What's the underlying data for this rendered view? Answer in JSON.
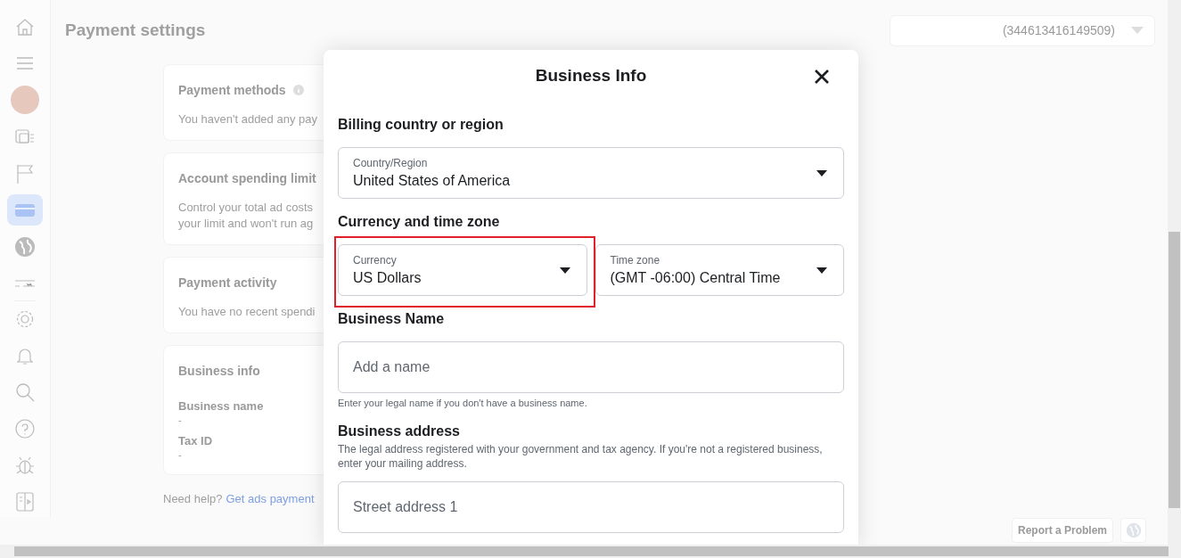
{
  "sidebar": {
    "items": [
      {
        "selected": false
      },
      {
        "selected": false
      },
      {
        "selected": false
      },
      {
        "selected": false
      },
      {
        "selected": false
      },
      {
        "selected": true
      },
      {
        "selected": false
      },
      {
        "selected": false
      },
      {
        "selected": false
      },
      {
        "selected": false
      },
      {
        "selected": false
      },
      {
        "selected": false
      },
      {
        "selected": false
      },
      {
        "selected": false
      }
    ]
  },
  "page": {
    "title": "Payment settings",
    "account_selector": {
      "value": "(344613416149509)"
    },
    "cards": [
      {
        "kind": "text",
        "title": "Payment methods",
        "info": true,
        "lines": [
          "You haven't added any pay"
        ]
      },
      {
        "kind": "text",
        "title": "Account spending limit",
        "lines": [
          "Control your total ad costs",
          "your limit and won't run ag"
        ]
      },
      {
        "kind": "text",
        "title": "Payment activity",
        "lines": [
          "You have no recent spendi"
        ]
      },
      {
        "kind": "fields",
        "title": "Business info",
        "fields": [
          {
            "label": "Business name",
            "value": "-"
          },
          {
            "label": "Tax ID",
            "value": "-"
          }
        ]
      }
    ],
    "help": {
      "text": "Need help?",
      "link": "Get ads payment"
    },
    "report_button": "Report a Problem"
  },
  "modal": {
    "title": "Business Info",
    "sections": [
      {
        "heading": "Billing country or region",
        "fields": [
          {
            "kind": "select",
            "label": "Country/Region",
            "value": "United States of America"
          }
        ]
      },
      {
        "heading": "Currency and time zone",
        "fields": [
          {
            "kind": "select",
            "label": "Currency",
            "value": "US Dollars",
            "highlighted": true
          },
          {
            "kind": "select",
            "label": "Time zone",
            "value": "(GMT -06:00) Central Time"
          }
        ]
      },
      {
        "heading": "Business Name",
        "fields": [
          {
            "kind": "input",
            "placeholder": "Add a name",
            "hint": "Enter your legal name if you don't have a business name."
          }
        ]
      },
      {
        "heading": "Business address",
        "description": "The legal address registered with your government and tax agency. If you're not a registered business, enter your mailing address.",
        "fields": [
          {
            "kind": "input",
            "placeholder": "Street address 1"
          }
        ]
      }
    ]
  }
}
